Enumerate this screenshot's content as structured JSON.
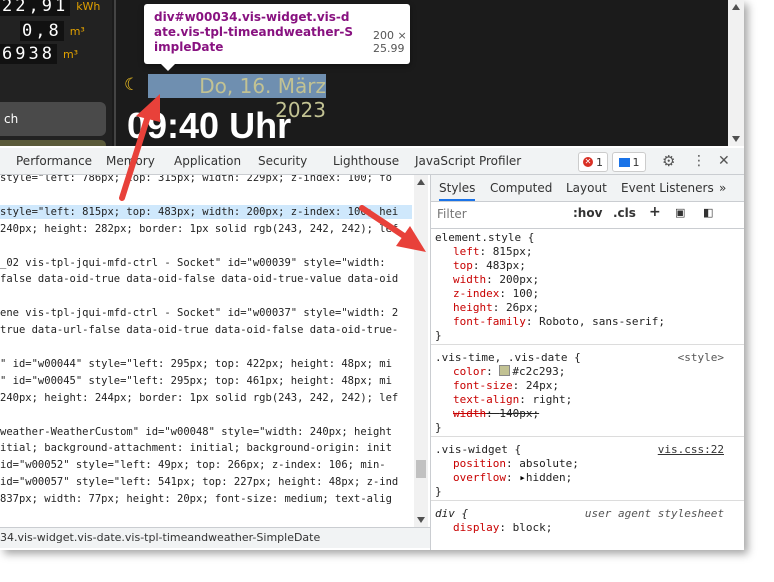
{
  "app": {
    "meters": [
      {
        "digits": "22,91",
        "unit": "kWh"
      },
      {
        "digits": "0,8",
        "unit": "m³"
      },
      {
        "digits": "6938",
        "unit": "m³"
      }
    ],
    "button_label": "ch",
    "date_text": "Do, 16. März 2023",
    "time_text": "09:40 Uhr",
    "moon_icon": "☾"
  },
  "tooltip": {
    "selector": "div#w00034.vis-widget.vis-date.vis-tpl-timeandweather-SimpleDate",
    "dimensions": "200 × 25.99"
  },
  "devtools": {
    "tabs": [
      "Performance",
      "Memory",
      "Application",
      "Security",
      "Lighthouse",
      "JavaScript Profiler"
    ],
    "error_count": "1",
    "message_count": "1",
    "elements_lines": [
      {
        "text": "style=\"left: 786px; top: 315px; width: 229px; z-index: 100; fo",
        "hl": false
      },
      {
        "text": "",
        "hl": false
      },
      {
        "text": "style=\"left: 815px; top: 483px; width: 200px; z-index: 100; hei",
        "hl": true
      },
      {
        "text": "240px; height: 282px; border: 1px solid rgb(243, 242, 242); lef",
        "hl": false
      },
      {
        "text": "",
        "hl": false
      },
      {
        "text": "_02 vis-tpl-jqui-mfd-ctrl - Socket\" id=\"w00039\" style=\"width:",
        "hl": false
      },
      {
        "text": "false data-oid-true data-oid-false data-oid-true-value data-oid",
        "hl": false
      },
      {
        "text": "",
        "hl": false
      },
      {
        "text": "ene vis-tpl-jqui-mfd-ctrl - Socket\" id=\"w00037\" style=\"width: 2",
        "hl": false
      },
      {
        "text": "true data-url-false data-oid-true data-oid-false data-oid-true-",
        "hl": false
      },
      {
        "text": "",
        "hl": false
      },
      {
        "text": "\" id=\"w00044\" style=\"left: 295px; top: 422px; height: 48px; mi",
        "hl": false
      },
      {
        "text": "\" id=\"w00045\" style=\"left: 295px; top: 461px; height: 48px; mi",
        "hl": false
      },
      {
        "text": "240px; height: 244px; border: 1px solid rgb(243, 242, 242); lef",
        "hl": false
      },
      {
        "text": "",
        "hl": false
      },
      {
        "text": "weather-WeatherCustom\" id=\"w00048\" style=\"width: 240px; height",
        "hl": false
      },
      {
        "text": "itial; background-attachment: initial; background-origin: init",
        "hl": false
      },
      {
        "text": " id=\"w00052\" style=\"left: 49px; top: 266px; z-index: 106; min-",
        "hl": false
      },
      {
        "text": "id=\"w00057\" style=\"left: 541px; top: 227px; height: 48px; z-ind",
        "hl": false
      },
      {
        "text": "837px; width: 77px; height: 20px; font-size: medium; text-alig",
        "hl": false
      }
    ],
    "breadcrumb": "34.vis-widget.vis-date.vis-tpl-timeandweather-SimpleDate",
    "styles_tabs": [
      "Styles",
      "Computed",
      "Layout",
      "Event Listeners",
      "»"
    ],
    "filter_placeholder": "Filter",
    "filter_buttons": [
      ":hov",
      ".cls",
      "+"
    ],
    "rules": [
      {
        "selector": "element.style {",
        "source": "",
        "props": [
          {
            "name": "left",
            "value": "815px;"
          },
          {
            "name": "top",
            "value": "483px;"
          },
          {
            "name": "width",
            "value": "200px;"
          },
          {
            "name": "z-index",
            "value": "100;"
          },
          {
            "name": "height",
            "value": "26px;"
          },
          {
            "name": "font-family",
            "value": "Roboto, sans-serif;"
          }
        ]
      },
      {
        "selector": ".vis-time, .vis-date {",
        "source": "<style>",
        "props": [
          {
            "name": "color",
            "value": "#c2c293;"
          },
          {
            "name": "font-size",
            "value": "24px;"
          },
          {
            "name": "text-align",
            "value": "right;"
          },
          {
            "name": "width",
            "value": "140px;"
          }
        ]
      },
      {
        "selector": ".vis-widget {",
        "source": "vis.css:22",
        "props": [
          {
            "name": "position",
            "value": "absolute;"
          },
          {
            "name": "overflow",
            "value": "hidden;"
          }
        ]
      },
      {
        "selector": "div {",
        "source": "user agent stylesheet",
        "props": [
          {
            "name": "display",
            "value": "block;"
          }
        ]
      }
    ],
    "close_brace": "}"
  }
}
